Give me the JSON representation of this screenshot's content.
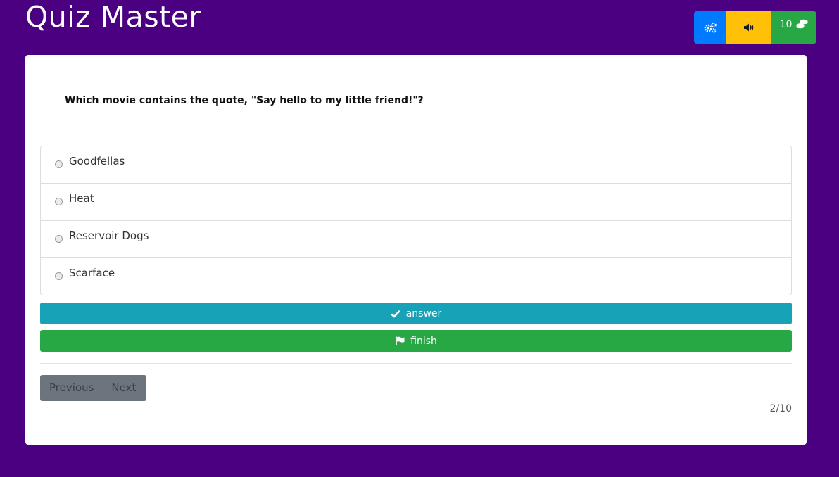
{
  "app": {
    "title": "Quiz Master"
  },
  "toolbar": {
    "settings_icon": "cogs-icon",
    "sound_icon": "volume-icon",
    "coins_count": "10",
    "coins_icon": "coins-icon"
  },
  "quiz": {
    "question": "Which movie contains the quote, \"Say hello to my little friend!\"?",
    "options": [
      {
        "label": "Goodfellas",
        "selected": false
      },
      {
        "label": "Heat",
        "selected": false
      },
      {
        "label": "Reservoir Dogs",
        "selected": false
      },
      {
        "label": "Scarface",
        "selected": false
      }
    ],
    "answer_label": "answer",
    "finish_label": "finish",
    "previous_label": "Previous",
    "next_label": "Next",
    "progress": "2/10"
  },
  "colors": {
    "background": "#4b0082",
    "settings_button": "#007bff",
    "sound_button": "#ffc107",
    "coins_button": "#28a745",
    "answer_button": "#17a2b8",
    "finish_button": "#28a745",
    "pager": "#6c757d"
  }
}
